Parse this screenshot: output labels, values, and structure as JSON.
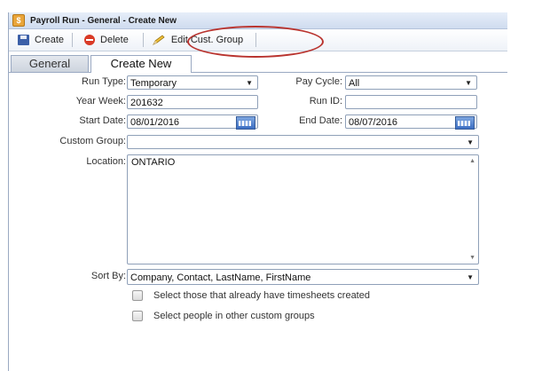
{
  "window": {
    "title": "Payroll Run - General - Create New",
    "app_icon": "$"
  },
  "toolbar": {
    "create_label": "Create",
    "delete_label": "Delete",
    "edit_group_label": "Edit Cust. Group"
  },
  "tabs": [
    {
      "label": "General",
      "active": false
    },
    {
      "label": "Create New",
      "active": true
    }
  ],
  "form": {
    "run_type": {
      "label": "Run Type:",
      "value": "Temporary"
    },
    "pay_cycle": {
      "label": "Pay Cycle:",
      "value": "All"
    },
    "year_week": {
      "label": "Year Week:",
      "value": "201632"
    },
    "run_id": {
      "label": "Run ID:",
      "value": ""
    },
    "start_date": {
      "label": "Start Date:",
      "value": "08/01/2016"
    },
    "end_date": {
      "label": "End Date:",
      "value": "08/07/2016"
    },
    "custom_group": {
      "label": "Custom Group:",
      "value": ""
    },
    "location": {
      "label": "Location:",
      "value": "ONTARIO"
    },
    "sort_by": {
      "label": "Sort By:",
      "value": "Company, Contact, LastName, FirstName"
    },
    "checkboxes": [
      {
        "label": "Select those that already have timesheets created",
        "checked": false
      },
      {
        "label": "Select people in other custom groups",
        "checked": false
      }
    ]
  },
  "colors": {
    "highlight": "#b9342f",
    "accent": "#3b6dc2"
  }
}
